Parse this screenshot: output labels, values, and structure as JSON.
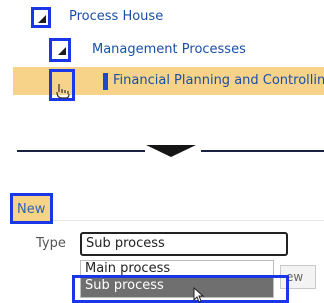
{
  "tree": {
    "root_label": "Process House",
    "child_label": "Management Processes",
    "leaf_label": "Financial Planning and Controlling"
  },
  "panel": {
    "new_tab_label": "New",
    "type_label": "Type",
    "type_value": "Sub process",
    "hidden_button_fragment": "ew",
    "dropdown_options": [
      "Main process",
      "Sub process"
    ],
    "selected_option": "Sub process"
  },
  "colors": {
    "highlight_blue": "#1a36e6",
    "selected_row": "#f7d38a",
    "link_text": "#1a4fa6",
    "selected_option_bg": "#6f6f6f"
  },
  "icons": {
    "expand_triangle": "expanded-triangle-icon",
    "hand_cursor": "hand-pointer-icon",
    "arrow_cursor": "arrow-cursor-icon",
    "transition_arrow": "down-arrow-icon"
  }
}
